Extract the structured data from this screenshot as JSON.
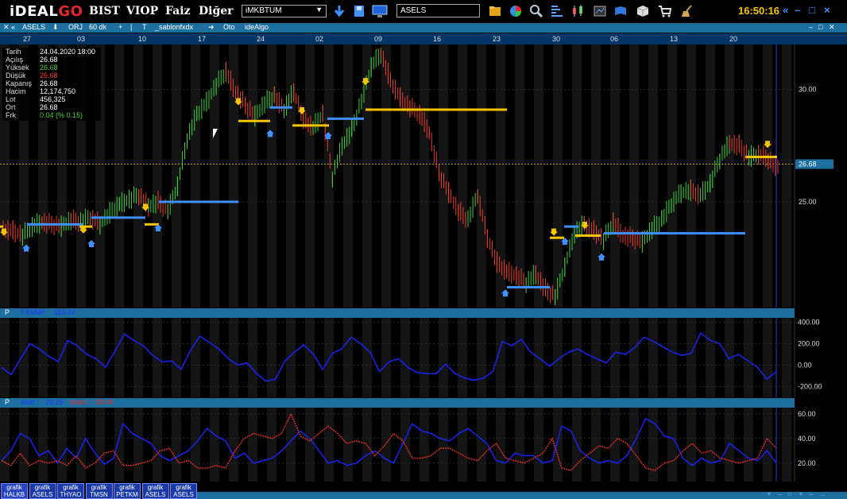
{
  "app": {
    "logo_a": "iDEAL",
    "logo_b": "GO",
    "menus": [
      "BIST",
      "VIOP",
      "Faiz",
      "Diğer"
    ],
    "market_select": "iMKBTUM",
    "symbol_input": "ASELS",
    "clock": "16:50:16",
    "colors": {
      "accent": "#1d6fa0",
      "brand_red": "#e7262c",
      "clock": "#f5c400"
    }
  },
  "chart_toolbar": {
    "symbol": "ASELS",
    "mode": "ORJ",
    "period": "60 dk",
    "template": "_sablonfxdx",
    "auto": "Oto",
    "algo": "ideAlgo"
  },
  "date_axis": [
    "27",
    "03",
    "10",
    "17",
    "24",
    "02",
    "09",
    "16",
    "23",
    "30",
    "06",
    "13",
    "20"
  ],
  "info_box": [
    {
      "key": "Tarih",
      "value": "24.04.2020 18:00",
      "tone": "white"
    },
    {
      "key": "Açılış",
      "value": "26.68",
      "tone": "white"
    },
    {
      "key": "Yüksek",
      "value": "26.68",
      "tone": "green"
    },
    {
      "key": "Düşük",
      "value": "26.68",
      "tone": "red"
    },
    {
      "key": "Kapanış",
      "value": "26.68",
      "tone": "white"
    },
    {
      "key": "Hacim",
      "value": "12,174,750",
      "tone": "white"
    },
    {
      "key": "Lot",
      "value": "456,325",
      "tone": "white"
    },
    {
      "key": "Ort",
      "value": "26.68",
      "tone": "white"
    },
    {
      "key": "Frk",
      "value": "0.04 (% 0.15)",
      "tone": "green"
    }
  ],
  "price_axis": {
    "ticks": [
      "30.00",
      "25.00"
    ],
    "last_price": "26.68"
  },
  "osc1": {
    "header_p": "P",
    "label": "FXSNP",
    "value": "110.74",
    "ticks": [
      "400.00",
      "200.00",
      "0.00",
      "-200.00"
    ],
    "ylim": [
      -300,
      440
    ]
  },
  "osc2": {
    "header_p": "P",
    "label_a": "dxar",
    "value_a": "20.25",
    "label_b": "dxarc",
    "value_b": "28.40",
    "ticks": [
      "60.00",
      "40.00",
      "20.00"
    ],
    "ylim": [
      5,
      65
    ]
  },
  "tabs": [
    {
      "l1": "grafik",
      "l2": "HALKB"
    },
    {
      "l1": "grafik",
      "l2": "ASELS"
    },
    {
      "l1": "grafik",
      "l2": "THYAO"
    },
    {
      "l1": "grafik",
      "l2": "TMSN"
    },
    {
      "l1": "grafik",
      "l2": "PETKM"
    },
    {
      "l1": "grafik",
      "l2": "ASELS"
    },
    {
      "l1": "grafik",
      "l2": "ASELS"
    }
  ],
  "chart_data": [
    {
      "type": "line",
      "title": "ASELS 60 dk",
      "ylim": [
        20.3,
        32.0
      ],
      "series": [
        {
          "name": "ASELS",
          "values": [
            23.8,
            23.7,
            23.5,
            23.9,
            24.1,
            24.0,
            23.9,
            24.2,
            24.1,
            24.3,
            24.0,
            24.5,
            24.9,
            25.1,
            25.3,
            24.8,
            25.0,
            24.6,
            25.7,
            27.8,
            28.9,
            29.4,
            30.2,
            30.8,
            29.9,
            29.3,
            28.8,
            29.4,
            29.7,
            29.1,
            29.9,
            28.7,
            28.3,
            28.9,
            26.1,
            27.5,
            28.2,
            29.5,
            31.0,
            31.6,
            30.4,
            29.6,
            29.2,
            28.9,
            28.1,
            26.3,
            25.4,
            24.6,
            24.2,
            25.3,
            23.4,
            22.3,
            21.9,
            21.7,
            21.4,
            21.8,
            21.1,
            20.8,
            22.1,
            23.6,
            24.0,
            23.7,
            23.3,
            24.1,
            23.5,
            23.4,
            23.2,
            23.8,
            24.2,
            24.9,
            25.4,
            25.5,
            25.3,
            25.8,
            26.9,
            27.6,
            27.5,
            27.0,
            27.1,
            26.9,
            26.5
          ]
        }
      ]
    },
    {
      "type": "line",
      "title": "FXSNP",
      "ylim": [
        -300,
        440
      ],
      "series": [
        {
          "name": "FXSNP",
          "values": [
            -20,
            -90,
            60,
            200,
            150,
            80,
            30,
            230,
            180,
            100,
            60,
            -20,
            130,
            290,
            230,
            180,
            90,
            30,
            40,
            -40,
            140,
            270,
            210,
            150,
            60,
            0,
            20,
            -80,
            -150,
            -130,
            40,
            120,
            190,
            100,
            -40,
            110,
            150,
            260,
            200,
            120,
            -60,
            30,
            60,
            -20,
            -70,
            -80,
            -80,
            10,
            -80,
            -120,
            -140,
            -120,
            -60,
            220,
            180,
            240,
            120,
            60,
            -10,
            60,
            120,
            150,
            100,
            60,
            20,
            120,
            100,
            160,
            260,
            220,
            170,
            120,
            90,
            110,
            300,
            230,
            200,
            60,
            100,
            40,
            -20,
            -130,
            -60
          ]
        }
      ]
    },
    {
      "type": "line",
      "title": "dxar / dxarc",
      "ylim": [
        5,
        65
      ],
      "series": [
        {
          "name": "dxar",
          "values": [
            22,
            30,
            44,
            40,
            26,
            30,
            20,
            32,
            24,
            40,
            28,
            19,
            24,
            52,
            44,
            40,
            36,
            26,
            22,
            26,
            30,
            38,
            48,
            42,
            38,
            24,
            28,
            20,
            22,
            24,
            30,
            38,
            46,
            40,
            30,
            20,
            22,
            18,
            20,
            26,
            30,
            24,
            20,
            36,
            52,
            46,
            44,
            40,
            38,
            44,
            48,
            42,
            36,
            22,
            20,
            28,
            26,
            26,
            20,
            22,
            50,
            46,
            30,
            24,
            20,
            22,
            20,
            26,
            40,
            56,
            52,
            42,
            40,
            24,
            18,
            24,
            20,
            22,
            36,
            30,
            24,
            22,
            30,
            20
          ]
        },
        {
          "name": "dxarc",
          "values": [
            22,
            18,
            28,
            18,
            22,
            20,
            22,
            18,
            26,
            16,
            20,
            28,
            30,
            18,
            18,
            20,
            22,
            30,
            32,
            20,
            22,
            16,
            16,
            18,
            16,
            30,
            40,
            44,
            42,
            40,
            44,
            60,
            42,
            38,
            44,
            50,
            44,
            36,
            38,
            36,
            26,
            34,
            44,
            38,
            24,
            24,
            26,
            32,
            32,
            28,
            24,
            22,
            30,
            36,
            24,
            22,
            20,
            24,
            28,
            40,
            16,
            14,
            22,
            28,
            34,
            32,
            40,
            36,
            26,
            16,
            14,
            20,
            22,
            30,
            36,
            28,
            30,
            24,
            22,
            20,
            22,
            24,
            40,
            32
          ]
        }
      ]
    }
  ]
}
